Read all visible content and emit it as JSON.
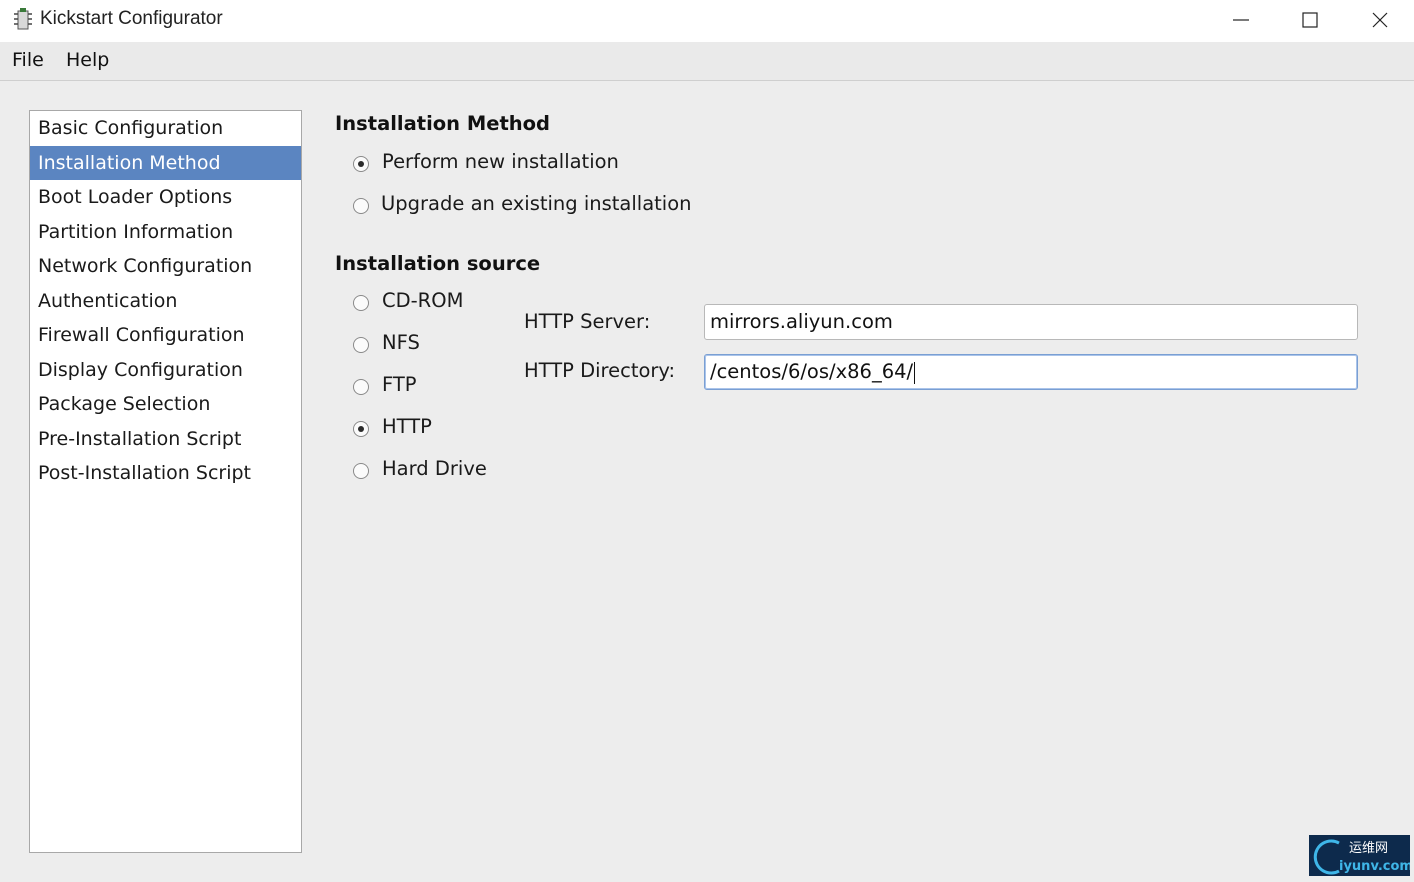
{
  "window": {
    "title": "Kickstart Configurator"
  },
  "menu": {
    "file": "File",
    "help": "Help"
  },
  "sidebar": {
    "items": [
      {
        "label": "Basic Configuration",
        "selected": false
      },
      {
        "label": "Installation Method",
        "selected": true
      },
      {
        "label": "Boot Loader Options",
        "selected": false
      },
      {
        "label": "Partition Information",
        "selected": false
      },
      {
        "label": "Network Configuration",
        "selected": false
      },
      {
        "label": "Authentication",
        "selected": false
      },
      {
        "label": "Firewall Configuration",
        "selected": false
      },
      {
        "label": "Display Configuration",
        "selected": false
      },
      {
        "label": "Package Selection",
        "selected": false
      },
      {
        "label": "Pre-Installation Script",
        "selected": false
      },
      {
        "label": "Post-Installation Script",
        "selected": false
      }
    ]
  },
  "installation_method": {
    "title": "Installation Method",
    "options": [
      {
        "label": "Perform new installation",
        "checked": true
      },
      {
        "label": "Upgrade an existing installation",
        "checked": false
      }
    ]
  },
  "installation_source": {
    "title": "Installation source",
    "options": [
      {
        "label": "CD-ROM",
        "checked": false
      },
      {
        "label": "NFS",
        "checked": false
      },
      {
        "label": "FTP",
        "checked": false
      },
      {
        "label": "HTTP",
        "checked": true
      },
      {
        "label": "Hard Drive",
        "checked": false
      }
    ],
    "http_server_label": "HTTP Server:",
    "http_server_value": "mirrors.aliyun.com",
    "http_directory_label": "HTTP Directory:",
    "http_directory_value": "/centos/6/os/x86_64/"
  },
  "watermark": {
    "text_cn": "运维网",
    "text_url": "iyunv.com"
  },
  "colors": {
    "selection": "#5b85c1",
    "background": "#ededed"
  }
}
